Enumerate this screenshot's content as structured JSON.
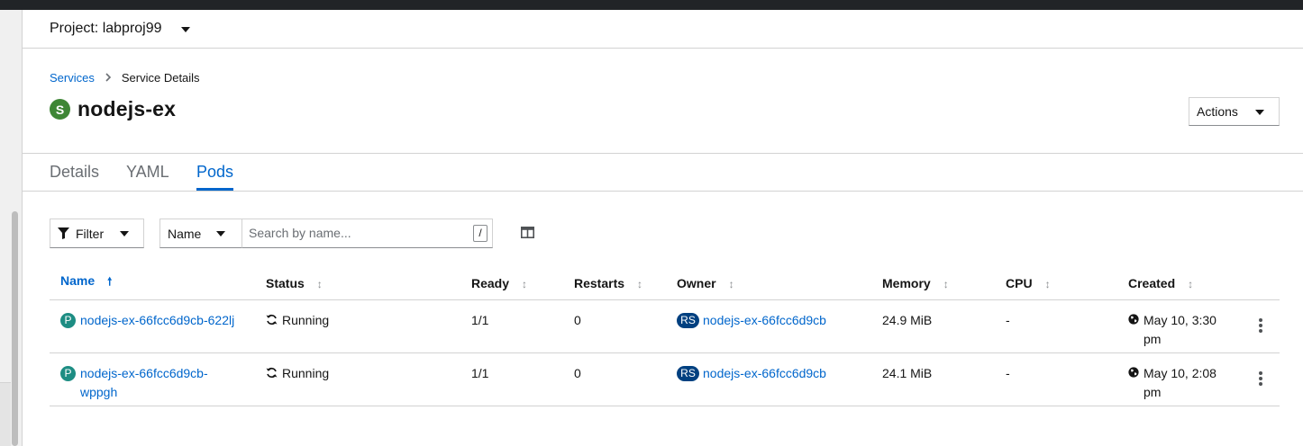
{
  "project": {
    "label": "Project: labproj99"
  },
  "breadcrumb": {
    "parent": "Services",
    "current": "Service Details"
  },
  "resource": {
    "badge": "S",
    "name": "nodejs-ex",
    "badge_color": "#3e8635"
  },
  "actions": {
    "label": "Actions"
  },
  "tabs": [
    {
      "label": "Details",
      "active": false
    },
    {
      "label": "YAML",
      "active": false
    },
    {
      "label": "Pods",
      "active": true
    }
  ],
  "toolbar": {
    "filter_label": "Filter",
    "name_select": "Name",
    "search_placeholder": "Search by name...",
    "shortcut_key": "/"
  },
  "table": {
    "headers": {
      "name": "Name",
      "status": "Status",
      "ready": "Ready",
      "restarts": "Restarts",
      "owner": "Owner",
      "memory": "Memory",
      "cpu": "CPU",
      "created": "Created"
    },
    "rows": [
      {
        "badge": "P",
        "name_line1": "nodejs-ex-66fcc6d9cb-622lj",
        "name_line2": "",
        "status": "Running",
        "ready": "1/1",
        "restarts": "0",
        "owner_badge": "RS",
        "owner": "nodejs-ex-66fcc6d9cb",
        "memory": "24.9 MiB",
        "cpu": "-",
        "created_line1": "May 10, 3:30",
        "created_line2": "pm"
      },
      {
        "badge": "P",
        "name_line1": "nodejs-ex-66fcc6d9cb-",
        "name_line2": "wppgh",
        "status": "Running",
        "ready": "1/1",
        "restarts": "0",
        "owner_badge": "RS",
        "owner": "nodejs-ex-66fcc6d9cb",
        "memory": "24.1 MiB",
        "cpu": "-",
        "created_line1": "May 10, 2:08",
        "created_line2": "pm"
      }
    ]
  },
  "colors": {
    "link": "#0066cc",
    "pod_badge": "#1d8d83",
    "replicaset_badge": "#004080"
  },
  "icons": [
    "caret-down-icon",
    "chevron-right-icon",
    "filter-icon",
    "columns-icon",
    "sort-asc-icon",
    "sort-icon",
    "sync-icon",
    "globe-icon",
    "kebab-icon"
  ]
}
